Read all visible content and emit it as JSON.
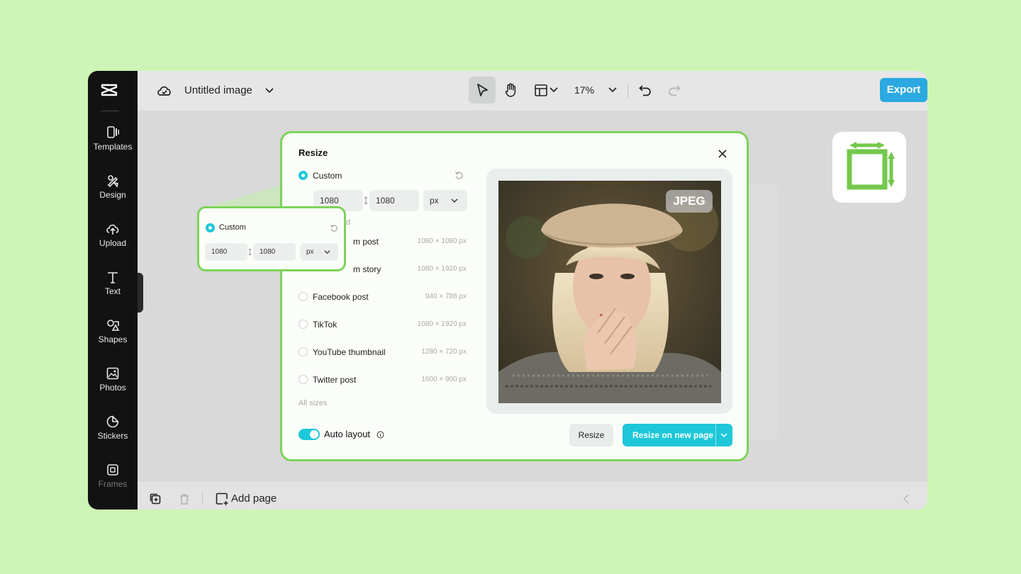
{
  "app": {
    "sidebar": {
      "items": [
        {
          "label": "Templates",
          "icon": "templates-icon"
        },
        {
          "label": "Design",
          "icon": "design-icon"
        },
        {
          "label": "Upload",
          "icon": "upload-icon"
        },
        {
          "label": "Text",
          "icon": "text-icon"
        },
        {
          "label": "Shapes",
          "icon": "shapes-icon"
        },
        {
          "label": "Photos",
          "icon": "photos-icon"
        },
        {
          "label": "Stickers",
          "icon": "stickers-icon"
        },
        {
          "label": "Frames",
          "icon": "frames-icon"
        }
      ]
    },
    "topbar": {
      "title": "Untitled image",
      "zoom": "17%",
      "export_label": "Export"
    },
    "bottombar": {
      "add_page_label": "Add page"
    }
  },
  "resize_dialog": {
    "title": "Resize",
    "custom": {
      "label": "Custom",
      "width": "1080",
      "height": "1080",
      "unit": "px"
    },
    "hidden_text": "ed",
    "presets": [
      {
        "label": "m post",
        "dims": "1080 × 1080 px"
      },
      {
        "label": "m story",
        "dims": "1080 × 1920 px"
      },
      {
        "label": "Facebook post",
        "dims": "940 × 788 px"
      },
      {
        "label": "TikTok",
        "dims": "1080 × 1920 px"
      },
      {
        "label": "YouTube thumbnail",
        "dims": "1280 × 720 px"
      },
      {
        "label": "Twitter post",
        "dims": "1600 × 900 px"
      }
    ],
    "all_sizes_label": "All sizes",
    "preview_badge": "JPEG",
    "auto_layout_label": "Auto layout",
    "auto_layout_on": true,
    "resize_button": "Resize",
    "resize_new_page_button": "Resize on new page"
  },
  "callout": {
    "label": "Custom",
    "width": "1080",
    "height": "1080",
    "unit": "px"
  },
  "colors": {
    "background": "#cdf5b5",
    "accent": "#1ec8d8",
    "highlight": "#7cd35a",
    "export": "#2ba9e0"
  }
}
